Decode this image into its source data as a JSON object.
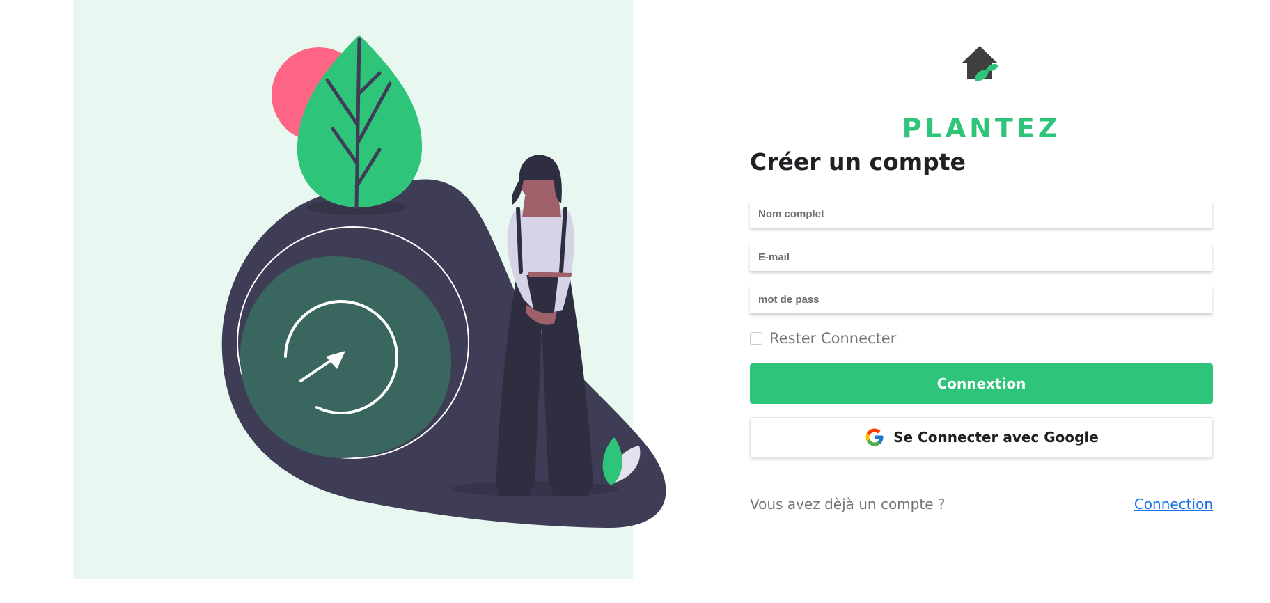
{
  "brand": {
    "name": "PLANTEZ"
  },
  "form": {
    "title": "Créer un compte",
    "fields": {
      "full_name": {
        "placeholder": "Nom complet",
        "value": ""
      },
      "email": {
        "placeholder": "E-mail",
        "value": ""
      },
      "password": {
        "placeholder": "mot de pass",
        "value": ""
      }
    },
    "remember": {
      "label": "Rester Connecter",
      "checked": false
    },
    "submit_label": "Connextion",
    "google_label": "Se Connecter avec Google"
  },
  "footer": {
    "text": "Vous avez dèjà un compte ?",
    "link_label": "Connection"
  },
  "icons": {
    "logo": "house-leaf-icon",
    "google": "google-icon"
  },
  "colors": {
    "accent": "#2ec47a",
    "illustration_bg": "#e8f7ef",
    "dark": "#3f3d56",
    "link": "#1a73e8",
    "pink": "#ff6584"
  }
}
